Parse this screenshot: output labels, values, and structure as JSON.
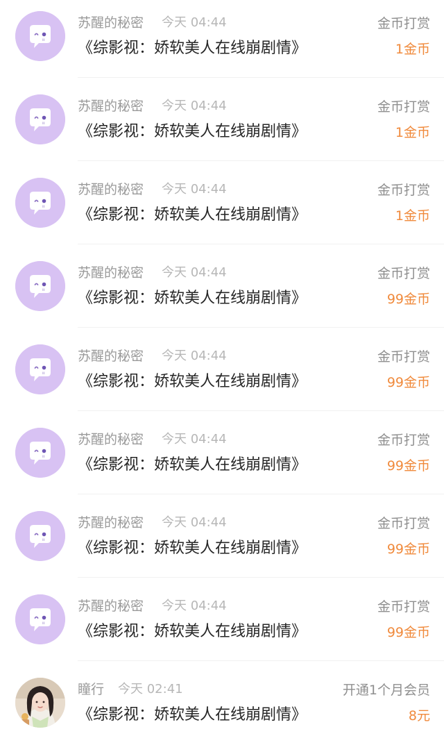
{
  "records": [
    {
      "user": "苏醒的秘密",
      "time": "今天 04:44",
      "book": "《综影视：娇软美人在线崩剧情》",
      "type": "金币打赏",
      "amount": "1金币",
      "avatar": "mascot-icon"
    },
    {
      "user": "苏醒的秘密",
      "time": "今天 04:44",
      "book": "《综影视：娇软美人在线崩剧情》",
      "type": "金币打赏",
      "amount": "1金币",
      "avatar": "mascot-icon"
    },
    {
      "user": "苏醒的秘密",
      "time": "今天 04:44",
      "book": "《综影视：娇软美人在线崩剧情》",
      "type": "金币打赏",
      "amount": "1金币",
      "avatar": "mascot-icon"
    },
    {
      "user": "苏醒的秘密",
      "time": "今天 04:44",
      "book": "《综影视：娇软美人在线崩剧情》",
      "type": "金币打赏",
      "amount": "99金币",
      "avatar": "mascot-icon"
    },
    {
      "user": "苏醒的秘密",
      "time": "今天 04:44",
      "book": "《综影视：娇软美人在线崩剧情》",
      "type": "金币打赏",
      "amount": "99金币",
      "avatar": "mascot-icon"
    },
    {
      "user": "苏醒的秘密",
      "time": "今天 04:44",
      "book": "《综影视：娇软美人在线崩剧情》",
      "type": "金币打赏",
      "amount": "99金币",
      "avatar": "mascot-icon"
    },
    {
      "user": "苏醒的秘密",
      "time": "今天 04:44",
      "book": "《综影视：娇软美人在线崩剧情》",
      "type": "金币打赏",
      "amount": "99金币",
      "avatar": "mascot-icon"
    },
    {
      "user": "苏醒的秘密",
      "time": "今天 04:44",
      "book": "《综影视：娇软美人在线崩剧情》",
      "type": "金币打赏",
      "amount": "99金币",
      "avatar": "mascot-icon"
    },
    {
      "user": "瞳行",
      "time": "今天 02:41",
      "book": "《综影视：娇软美人在线崩剧情》",
      "type": "开通1个月会员",
      "amount": "8元",
      "avatar": "user-photo"
    }
  ],
  "colors": {
    "avatar_bg": "#d8c2f3",
    "amount": "#f08a3c",
    "name": "#9a9a9a",
    "time": "#b7b7b7",
    "title": "#262626"
  }
}
